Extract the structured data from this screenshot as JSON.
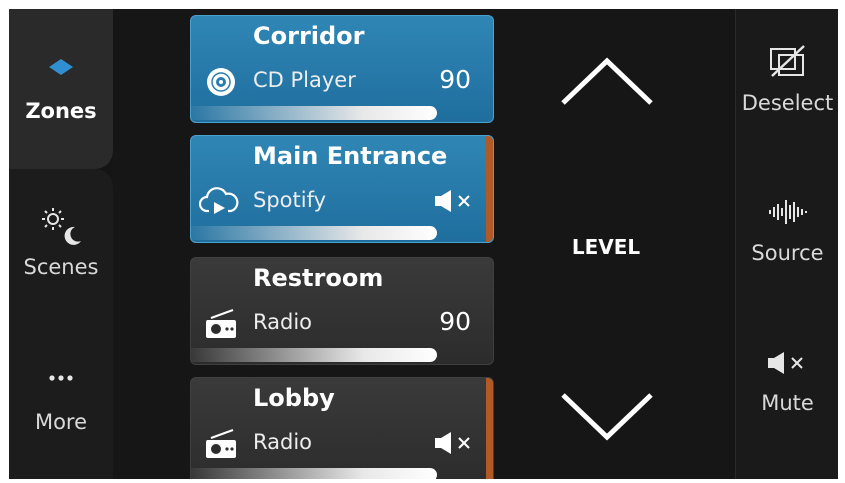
{
  "nav": {
    "items": [
      {
        "label": "Zones",
        "icon": "zones-diamond-icon"
      },
      {
        "label": "Scenes",
        "icon": "day-night-icon"
      },
      {
        "label": "More",
        "icon": "more-dots-icon"
      }
    ]
  },
  "zones": [
    {
      "name": "Corridor",
      "source": "CD Player",
      "level": "90",
      "source_icon": "cd-icon"
    },
    {
      "name": "Main Entrance",
      "source": "Spotify",
      "level": "",
      "source_icon": "cloud-play-icon",
      "muted": true
    },
    {
      "name": "Restroom",
      "source": "Radio",
      "level": "90",
      "source_icon": "radio-icon"
    },
    {
      "name": "Lobby",
      "source": "Radio",
      "level": "",
      "source_icon": "radio-icon",
      "muted": true
    }
  ],
  "level": {
    "label": "LEVEL"
  },
  "actions": [
    {
      "label": "Deselect",
      "icon": "deselect-icon"
    },
    {
      "label": "Source",
      "icon": "waveform-icon"
    },
    {
      "label": "Mute",
      "icon": "mute-icon"
    }
  ],
  "colors": {
    "accent_selected": "#2f86b4",
    "marker": "#b25a26",
    "background": "#161616"
  }
}
